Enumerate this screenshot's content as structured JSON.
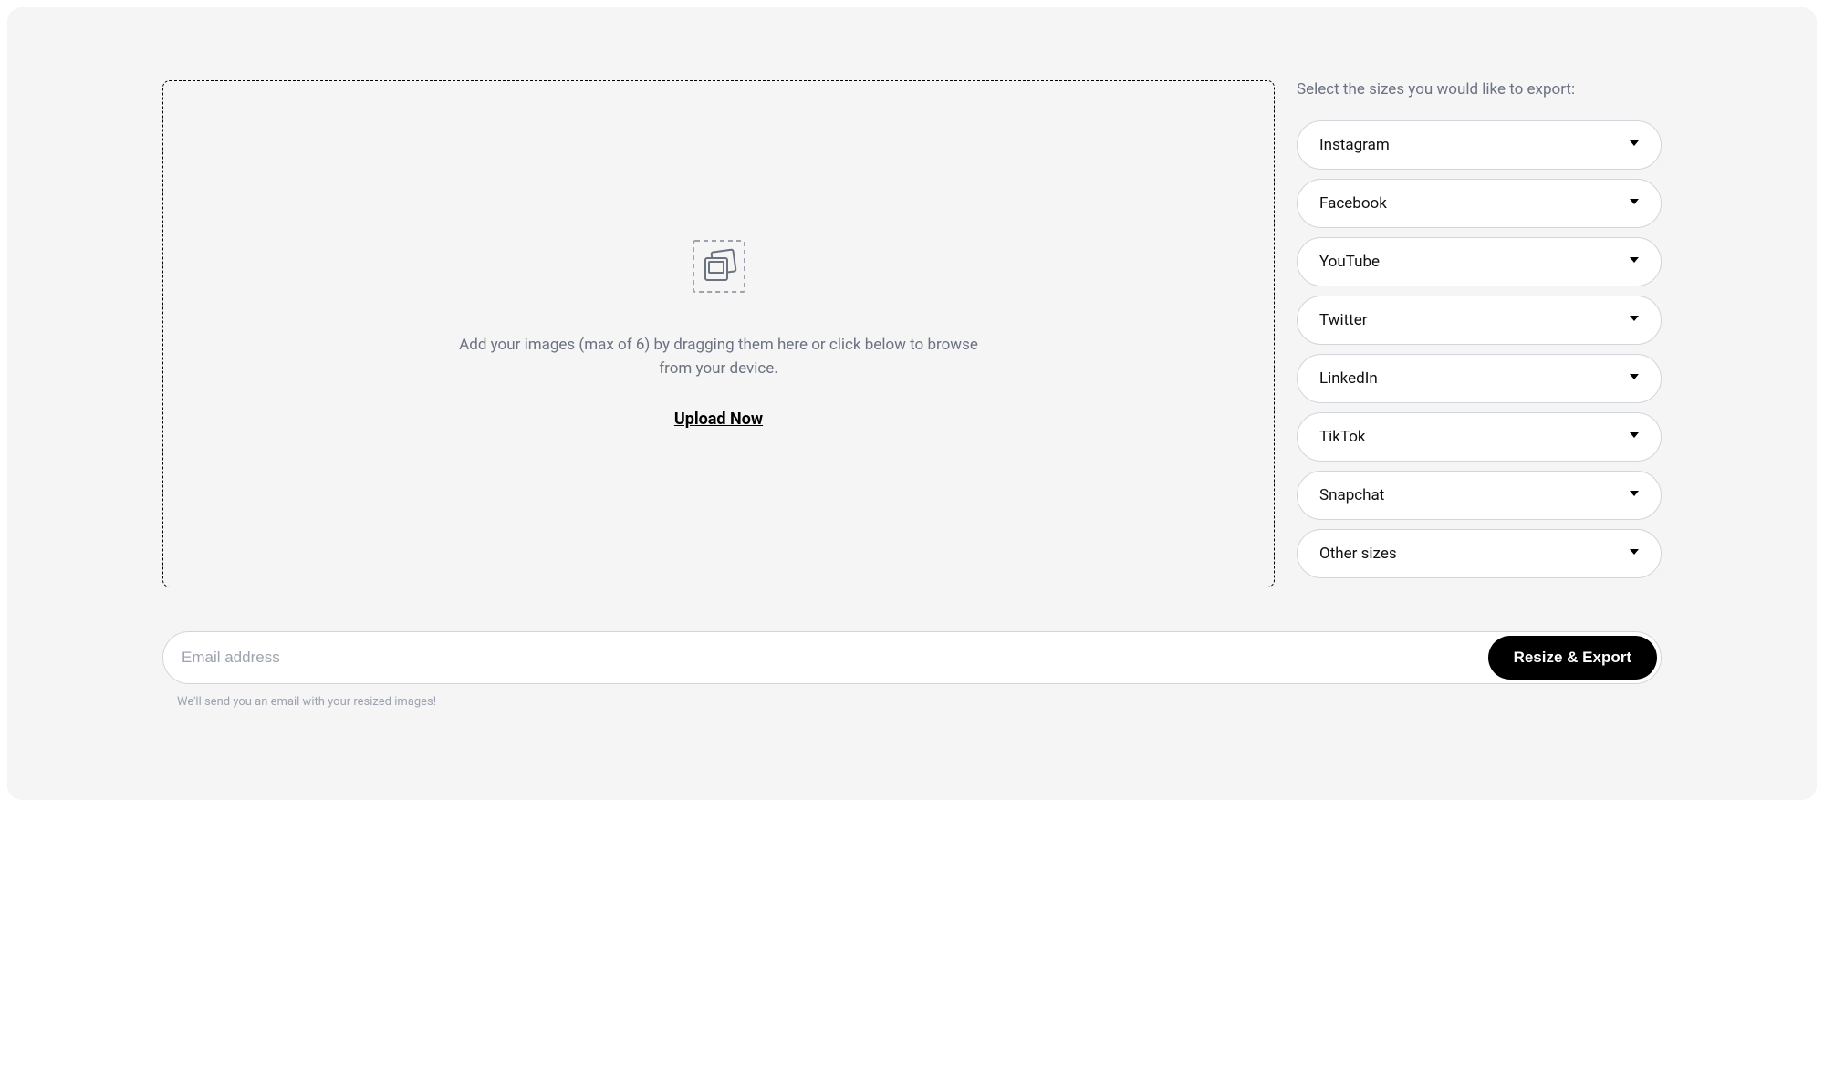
{
  "dropzone": {
    "instructions": "Add your images (max of 6) by dragging them here or click below to browse from your device.",
    "upload_label": "Upload Now"
  },
  "sizes": {
    "title": "Select the sizes you would like to export:",
    "options": [
      {
        "label": "Instagram"
      },
      {
        "label": "Facebook"
      },
      {
        "label": "YouTube"
      },
      {
        "label": "Twitter"
      },
      {
        "label": "LinkedIn"
      },
      {
        "label": "TikTok"
      },
      {
        "label": "Snapchat"
      },
      {
        "label": "Other sizes"
      }
    ]
  },
  "email": {
    "placeholder": "Email address",
    "button_label": "Resize & Export",
    "hint": "We'll send you an email with your resized images!"
  }
}
